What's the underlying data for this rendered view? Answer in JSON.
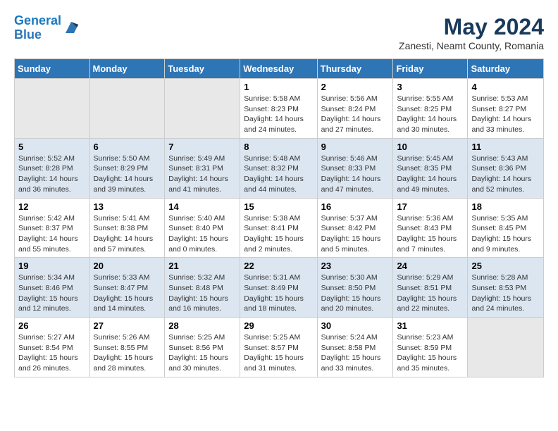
{
  "header": {
    "logo_line1": "General",
    "logo_line2": "Blue",
    "month_title": "May 2024",
    "location": "Zanesti, Neamt County, Romania"
  },
  "days_of_week": [
    "Sunday",
    "Monday",
    "Tuesday",
    "Wednesday",
    "Thursday",
    "Friday",
    "Saturday"
  ],
  "weeks": [
    [
      {
        "day": "",
        "info": ""
      },
      {
        "day": "",
        "info": ""
      },
      {
        "day": "",
        "info": ""
      },
      {
        "day": "1",
        "info": "Sunrise: 5:58 AM\nSunset: 8:23 PM\nDaylight: 14 hours\nand 24 minutes."
      },
      {
        "day": "2",
        "info": "Sunrise: 5:56 AM\nSunset: 8:24 PM\nDaylight: 14 hours\nand 27 minutes."
      },
      {
        "day": "3",
        "info": "Sunrise: 5:55 AM\nSunset: 8:25 PM\nDaylight: 14 hours\nand 30 minutes."
      },
      {
        "day": "4",
        "info": "Sunrise: 5:53 AM\nSunset: 8:27 PM\nDaylight: 14 hours\nand 33 minutes."
      }
    ],
    [
      {
        "day": "5",
        "info": "Sunrise: 5:52 AM\nSunset: 8:28 PM\nDaylight: 14 hours\nand 36 minutes."
      },
      {
        "day": "6",
        "info": "Sunrise: 5:50 AM\nSunset: 8:29 PM\nDaylight: 14 hours\nand 39 minutes."
      },
      {
        "day": "7",
        "info": "Sunrise: 5:49 AM\nSunset: 8:31 PM\nDaylight: 14 hours\nand 41 minutes."
      },
      {
        "day": "8",
        "info": "Sunrise: 5:48 AM\nSunset: 8:32 PM\nDaylight: 14 hours\nand 44 minutes."
      },
      {
        "day": "9",
        "info": "Sunrise: 5:46 AM\nSunset: 8:33 PM\nDaylight: 14 hours\nand 47 minutes."
      },
      {
        "day": "10",
        "info": "Sunrise: 5:45 AM\nSunset: 8:35 PM\nDaylight: 14 hours\nand 49 minutes."
      },
      {
        "day": "11",
        "info": "Sunrise: 5:43 AM\nSunset: 8:36 PM\nDaylight: 14 hours\nand 52 minutes."
      }
    ],
    [
      {
        "day": "12",
        "info": "Sunrise: 5:42 AM\nSunset: 8:37 PM\nDaylight: 14 hours\nand 55 minutes."
      },
      {
        "day": "13",
        "info": "Sunrise: 5:41 AM\nSunset: 8:38 PM\nDaylight: 14 hours\nand 57 minutes."
      },
      {
        "day": "14",
        "info": "Sunrise: 5:40 AM\nSunset: 8:40 PM\nDaylight: 15 hours\nand 0 minutes."
      },
      {
        "day": "15",
        "info": "Sunrise: 5:38 AM\nSunset: 8:41 PM\nDaylight: 15 hours\nand 2 minutes."
      },
      {
        "day": "16",
        "info": "Sunrise: 5:37 AM\nSunset: 8:42 PM\nDaylight: 15 hours\nand 5 minutes."
      },
      {
        "day": "17",
        "info": "Sunrise: 5:36 AM\nSunset: 8:43 PM\nDaylight: 15 hours\nand 7 minutes."
      },
      {
        "day": "18",
        "info": "Sunrise: 5:35 AM\nSunset: 8:45 PM\nDaylight: 15 hours\nand 9 minutes."
      }
    ],
    [
      {
        "day": "19",
        "info": "Sunrise: 5:34 AM\nSunset: 8:46 PM\nDaylight: 15 hours\nand 12 minutes."
      },
      {
        "day": "20",
        "info": "Sunrise: 5:33 AM\nSunset: 8:47 PM\nDaylight: 15 hours\nand 14 minutes."
      },
      {
        "day": "21",
        "info": "Sunrise: 5:32 AM\nSunset: 8:48 PM\nDaylight: 15 hours\nand 16 minutes."
      },
      {
        "day": "22",
        "info": "Sunrise: 5:31 AM\nSunset: 8:49 PM\nDaylight: 15 hours\nand 18 minutes."
      },
      {
        "day": "23",
        "info": "Sunrise: 5:30 AM\nSunset: 8:50 PM\nDaylight: 15 hours\nand 20 minutes."
      },
      {
        "day": "24",
        "info": "Sunrise: 5:29 AM\nSunset: 8:51 PM\nDaylight: 15 hours\nand 22 minutes."
      },
      {
        "day": "25",
        "info": "Sunrise: 5:28 AM\nSunset: 8:53 PM\nDaylight: 15 hours\nand 24 minutes."
      }
    ],
    [
      {
        "day": "26",
        "info": "Sunrise: 5:27 AM\nSunset: 8:54 PM\nDaylight: 15 hours\nand 26 minutes."
      },
      {
        "day": "27",
        "info": "Sunrise: 5:26 AM\nSunset: 8:55 PM\nDaylight: 15 hours\nand 28 minutes."
      },
      {
        "day": "28",
        "info": "Sunrise: 5:25 AM\nSunset: 8:56 PM\nDaylight: 15 hours\nand 30 minutes."
      },
      {
        "day": "29",
        "info": "Sunrise: 5:25 AM\nSunset: 8:57 PM\nDaylight: 15 hours\nand 31 minutes."
      },
      {
        "day": "30",
        "info": "Sunrise: 5:24 AM\nSunset: 8:58 PM\nDaylight: 15 hours\nand 33 minutes."
      },
      {
        "day": "31",
        "info": "Sunrise: 5:23 AM\nSunset: 8:59 PM\nDaylight: 15 hours\nand 35 minutes."
      },
      {
        "day": "",
        "info": ""
      }
    ]
  ]
}
